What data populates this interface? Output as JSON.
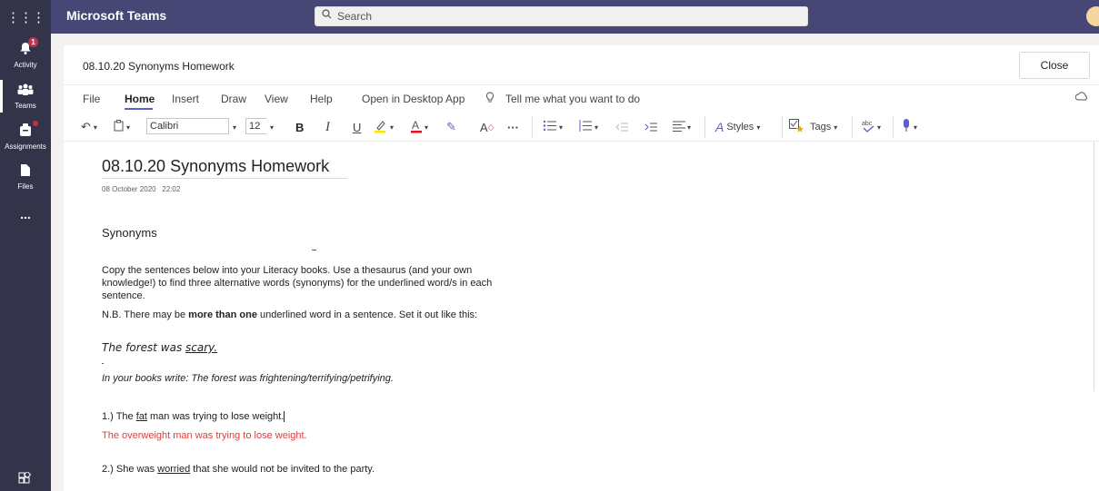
{
  "app": {
    "title": "Microsoft Teams"
  },
  "search": {
    "placeholder": "Search"
  },
  "rail": {
    "activity_label": "Activity",
    "activity_badge": "1",
    "teams_label": "Teams",
    "assignments_label": "Assignments",
    "files_label": "Files",
    "more": "..."
  },
  "doc": {
    "header_title": "08.10.20 Synonyms Homework",
    "close_label": "Close"
  },
  "menu": {
    "file": "File",
    "home": "Home",
    "insert": "Insert",
    "draw": "Draw",
    "view": "View",
    "help": "Help",
    "open_desktop": "Open in Desktop App",
    "tell_me": "Tell me what you want to do"
  },
  "toolbar": {
    "font_name": "Calibri",
    "font_size": "12",
    "bold": "B",
    "italic": "I",
    "underline": "U",
    "more": "···",
    "styles": "Styles",
    "tags": "Tags"
  },
  "note": {
    "title": "08.10.20 Synonyms Homework",
    "date": "08 October 2020",
    "time": "22:02",
    "heading": "Synonyms",
    "instructions_1": "Copy the sentences below into your Literacy books. Use a thesaurus (and your own",
    "instructions_2": "knowledge!) to find three alternative words (synonyms) for the underlined word/s in each",
    "instructions_3": "sentence.",
    "nb_prefix": "N.B. There may be ",
    "nb_bold": "more than one",
    "nb_suffix": " underlined word in a sentence. Set it out like this:",
    "example_prefix": "The forest was ",
    "example_underlined": "scary.",
    "books_line": "In your books write: The forest was frightening/terrifying/petrifying.",
    "s1_prefix": "1.) The ",
    "s1_underlined": "fat",
    "s1_suffix": " man was trying to lose weight.",
    "s1_answer": "The overweight man was trying to lose weight.",
    "s2_prefix": "2.) She was ",
    "s2_underlined": "worried",
    "s2_suffix": " that she would not be invited to the party."
  }
}
